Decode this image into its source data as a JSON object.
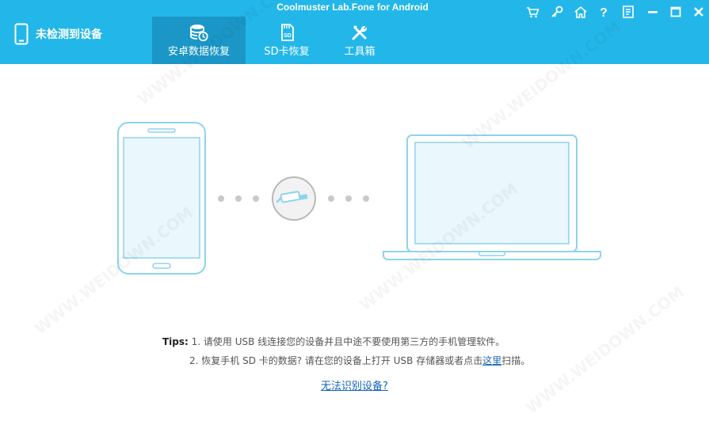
{
  "window": {
    "title": "Coolmuster Lab.Fone for Android"
  },
  "device_status": {
    "label": "未检测到设备",
    "icon": "phone-icon"
  },
  "tabs": [
    {
      "label": "安卓数据恢复",
      "icon": "data-recovery-icon",
      "active": true
    },
    {
      "label": "SD卡恢复",
      "icon": "sd-card-icon",
      "active": false
    },
    {
      "label": "工具箱",
      "icon": "tools-icon",
      "active": false
    }
  ],
  "window_controls": [
    "cart-icon",
    "key-icon",
    "home-icon",
    "help-icon",
    "feedback-icon",
    "minimize-icon",
    "maximize-icon",
    "close-icon"
  ],
  "tips": {
    "label": "Tips:",
    "line1": "1. 请使用 USB 线连接您的设备并且中途不要使用第三方的手机管理软件。",
    "line2_prefix": "2. 恢复手机 SD 卡的数据? 请在您的设备上打开 USB 存储器或者点击",
    "line2_link": "这里",
    "line2_suffix": "扫描。"
  },
  "no_device_link": "无法识别设备?",
  "watermark": "WWW.WEIDOWN.COM",
  "colors": {
    "header_bg": "#23b7e9",
    "active_tab_bg": "#1a97c7",
    "illustration_stroke": "#8ed3ee",
    "illustration_fill": "#eaf7fd",
    "link": "#1565b8"
  }
}
